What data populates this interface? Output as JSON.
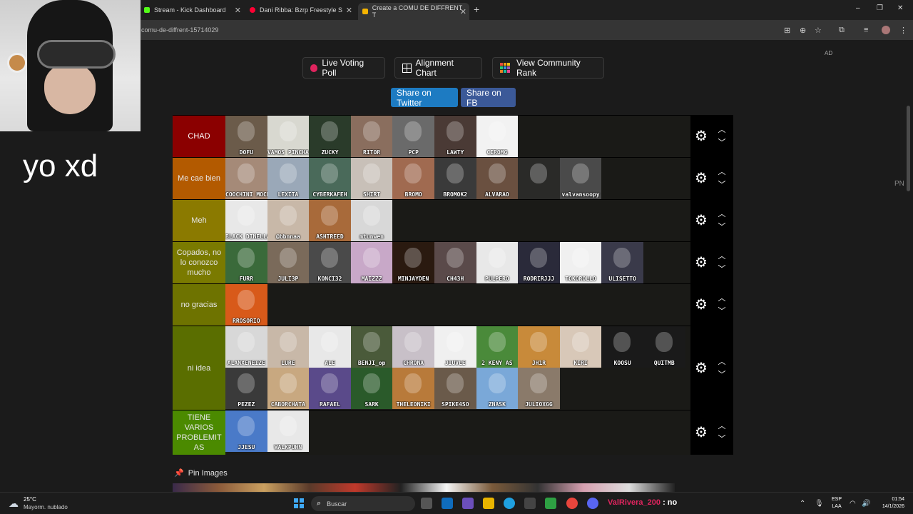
{
  "browser": {
    "tabs": [
      {
        "title": "Stream - Kick Dashboard",
        "favicon_color": "#53fc18",
        "active": false
      },
      {
        "title": "Dani Ribba: Bzrp Freestyle S",
        "favicon_color": "#ff0033",
        "active": false
      },
      {
        "title": "Create a COMU DE DIFFRENT T",
        "favicon_color": "#f5b400",
        "active": true
      }
    ],
    "url": "comu-de-diffrent-15714029",
    "window_controls": {
      "minimize": "–",
      "restore": "❐",
      "close": "✕"
    }
  },
  "page": {
    "ad_label": "AD",
    "side_label": "PN",
    "buttons": {
      "live_voting": "Live Voting Poll",
      "alignment_chart": "Alignment Chart",
      "community_rank": "View Community Rank",
      "share_twitter": "Share on Twitter",
      "share_fb": "Share on FB"
    },
    "colors": {
      "twitter": "#1d7bc2",
      "facebook": "#3b5998"
    },
    "pin_images": "Pin Images"
  },
  "tiers": [
    {
      "label": "CHAD",
      "color": "#8b0000",
      "text_color": "#ffffff",
      "items": [
        {
          "cap": "DOFU",
          "bg": "#6b5b4a"
        },
        {
          "cap": "VAMOS PINCHA",
          "bg": "#d8d8d0"
        },
        {
          "cap": "ZUCKY",
          "bg": "#2a3b2a"
        },
        {
          "cap": "RITOR",
          "bg": "#8a6e5e"
        },
        {
          "cap": "PCP",
          "bg": "#6a6a6a"
        },
        {
          "cap": "LAWTY",
          "bg": "#4a3a35"
        },
        {
          "cap": "CIROMG",
          "bg": "#f2f2f2"
        }
      ]
    },
    {
      "label": "Me cae bien",
      "color": "#b35a00",
      "text_color": "#e6e6e6",
      "items": [
        {
          "cap": "COOCHINI MOCHINICRY",
          "bg": "#a58a78"
        },
        {
          "cap": "LEXITA",
          "bg": "#9aa8b8"
        },
        {
          "cap": "CYBERKAFEH",
          "bg": "#4a6a5a"
        },
        {
          "cap": "SHIRT",
          "bg": "#c8c0b8"
        },
        {
          "cap": "BROMO",
          "bg": "#a06a50"
        },
        {
          "cap": "BROMOK2",
          "bg": "#3a3a3a"
        },
        {
          "cap": "ALVARAO",
          "bg": "#6a5040"
        },
        {
          "cap": "",
          "bg": "#2a2a28"
        },
        {
          "cap": "valvansoopy",
          "bg": "#4a4a4a"
        }
      ]
    },
    {
      "label": "Meh",
      "color": "#8b7a00",
      "text_color": "#e6e6e6",
      "items": [
        {
          "cap": "BLACK DINELLA",
          "bg": "#e8e8e8"
        },
        {
          "cap": "@bbnnaa",
          "bg": "#c8b8a8"
        },
        {
          "cap": "ASHTREED",
          "bg": "#a86a3a"
        },
        {
          "cap": "mtunwen",
          "bg": "#d8d8d8"
        }
      ]
    },
    {
      "label": "Copados, no lo conozco mucho",
      "color": "#7a7a00",
      "text_color": "#e6e6e6",
      "items": [
        {
          "cap": "FURR",
          "bg": "#3a6a3a"
        },
        {
          "cap": "JULI3P",
          "bg": "#7a6a5a"
        },
        {
          "cap": "KONCI32",
          "bg": "#4a4a4a"
        },
        {
          "cap": "MAIZZZ",
          "bg": "#c8a8c8"
        },
        {
          "cap": "MINJAYDEN",
          "bg": "#2a1a10"
        },
        {
          "cap": "CH43H",
          "bg": "#5a4a4a"
        },
        {
          "cap": "PULPERO",
          "bg": "#e8e8e8"
        },
        {
          "cap": "RODRIRJJJ",
          "bg": "#2a2a3a"
        },
        {
          "cap": "TOKOROLLO",
          "bg": "#f0f0f0"
        },
        {
          "cap": "ULISETTO",
          "bg": "#3a3a4a"
        }
      ]
    },
    {
      "label": "no gracias",
      "color": "#6e7300",
      "text_color": "#e6e6e6",
      "items": [
        {
          "cap": "RROSORIO",
          "bg": "#d85a1a"
        }
      ]
    },
    {
      "label": "ni idea",
      "color": "#5a6e00",
      "text_color": "#e6e6e6",
      "items": [
        {
          "cap": "ALANXENEIZE",
          "bg": "#d8d8d8"
        },
        {
          "cap": "LURE",
          "bg": "#c8b8a8"
        },
        {
          "cap": "ALE",
          "bg": "#e8e8e8"
        },
        {
          "cap": "BENJI_op",
          "bg": "#4a5a3a"
        },
        {
          "cap": "CHRONA",
          "bg": "#c8c0c8"
        },
        {
          "cap": "JIUVLE",
          "bg": "#f0f0f0"
        },
        {
          "cap": "2 KENY AS",
          "bg": "#4a8a3a"
        },
        {
          "cap": "JH1R",
          "bg": "#c88a3a"
        },
        {
          "cap": "KIRI",
          "bg": "#d8c8b8"
        },
        {
          "cap": "KOOSU",
          "bg": "#1a1a1a"
        },
        {
          "cap": "QUITMB",
          "bg": "#1a1a1a"
        },
        {
          "cap": "PEZEZ",
          "bg": "#3a3a3a"
        },
        {
          "cap": "CABORCHATA",
          "bg": "#c8a880"
        },
        {
          "cap": "RAFAEL",
          "bg": "#5a4a8a"
        },
        {
          "cap": "SARK",
          "bg": "#2a5a2a"
        },
        {
          "cap": "THELEONIKI",
          "bg": "#b87a3a"
        },
        {
          "cap": "SPIKE4SO",
          "bg": "#6a5a4a"
        },
        {
          "cap": "ZNASK",
          "bg": "#7aa8d8"
        },
        {
          "cap": "JULIOXGG",
          "bg": "#8a7a6a"
        }
      ]
    },
    {
      "label": "TIENE VARIOS PROBLEMIT AS",
      "color": "#4b8a00",
      "text_color": "#e6e6e6",
      "items": [
        {
          "cap": "JJESU",
          "bg": "#4a7ac8"
        },
        {
          "cap": "WALKPUHN",
          "bg": "#e8e8e8"
        }
      ]
    }
  ],
  "overlay": {
    "caption": "yo xd"
  },
  "taskbar": {
    "temperature": "25°C",
    "condition": "Mayorm. nublado",
    "search_placeholder": "Buscar",
    "chat_user": "ValRivera_200",
    "chat_message": " : no",
    "lang_top": "ESP",
    "lang_bottom": "LAA",
    "time": "01:54",
    "date": "14/1/2026"
  }
}
